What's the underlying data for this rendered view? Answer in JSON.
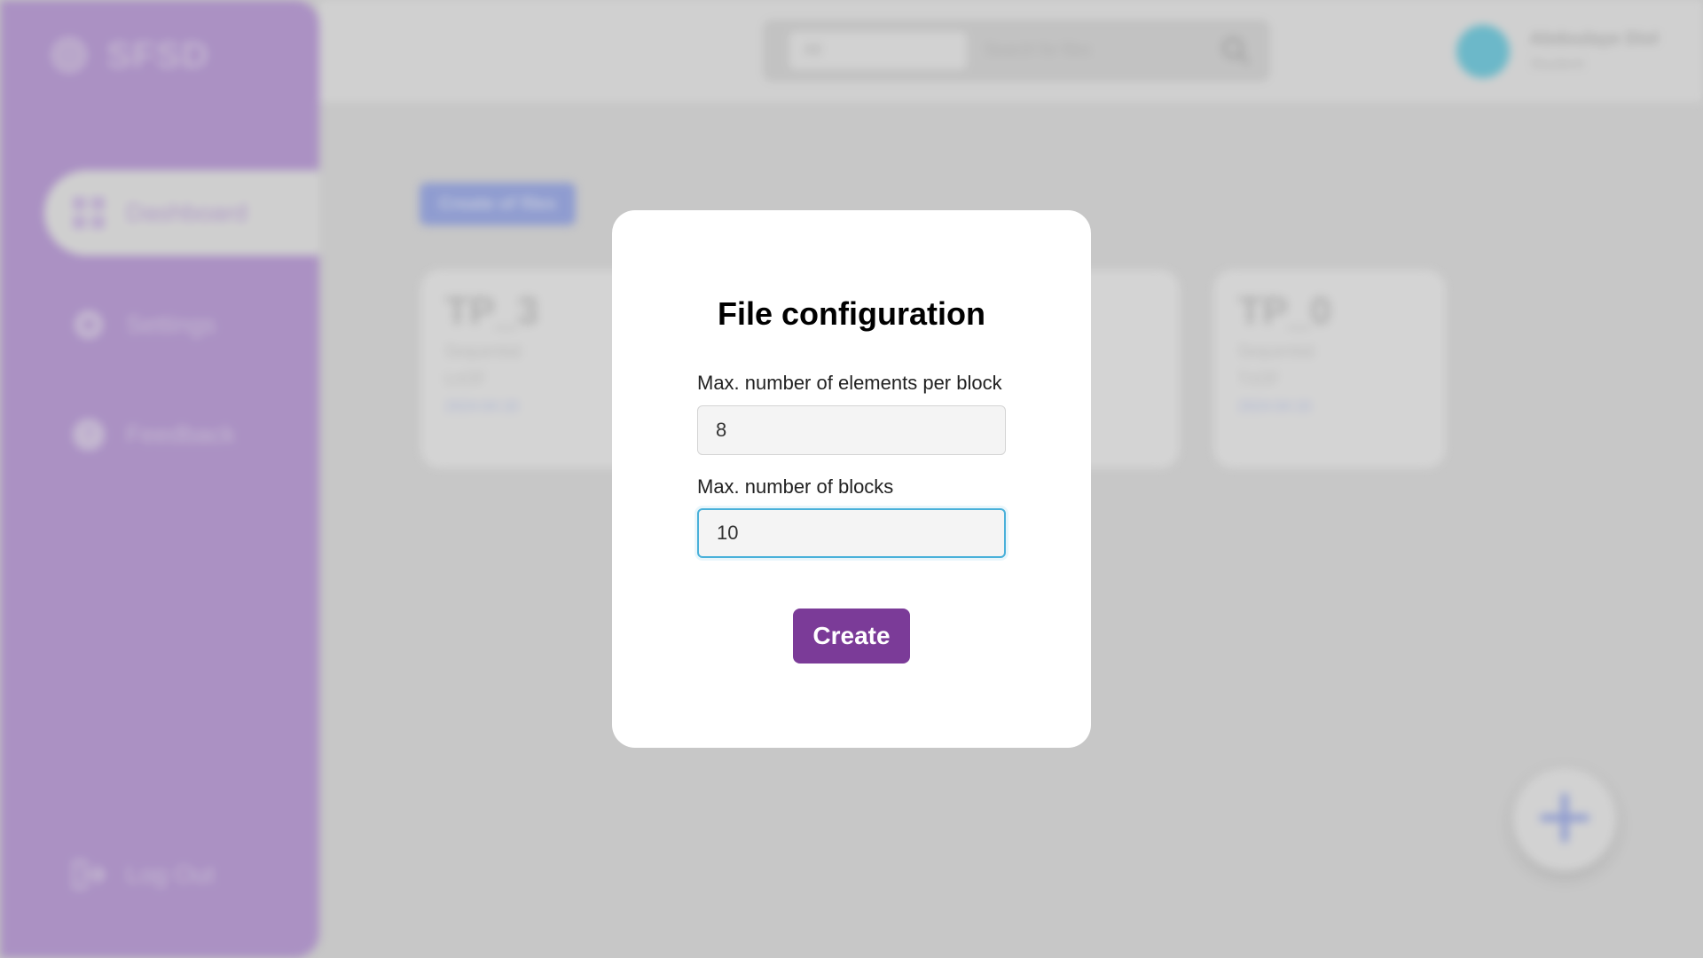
{
  "app": {
    "logo_text": "SFSD",
    "nav": [
      {
        "label": "Dashboard",
        "icon": "grid-icon"
      },
      {
        "label": "Settings",
        "icon": "gear-icon"
      },
      {
        "label": "Feedback",
        "icon": "question-icon"
      }
    ],
    "logout_label": "Log Out",
    "search": {
      "select_value": "All",
      "placeholder": "Search for files"
    },
    "user": {
      "name": "Abdoulaye Diol",
      "role": "Student"
    },
    "main_button": "Create of files",
    "cards": [
      {
        "title": "TP_3",
        "line1": "Sequential",
        "line2": "LnOF",
        "date": "2024-04-18"
      },
      {
        "title": "TP_0",
        "line1": "Sequential",
        "line2": "TnOF",
        "date": "2024-04-16"
      }
    ],
    "colors": {
      "sidebar": "#c7a9e4",
      "accent": "#7b3b98",
      "focus": "#4ab1da"
    }
  },
  "modal": {
    "title": "File configuration",
    "field1_label": "Max. number of elements per block",
    "field1_value": "8",
    "field2_label": "Max. number of blocks",
    "field2_value": "10",
    "submit_label": "Create"
  }
}
